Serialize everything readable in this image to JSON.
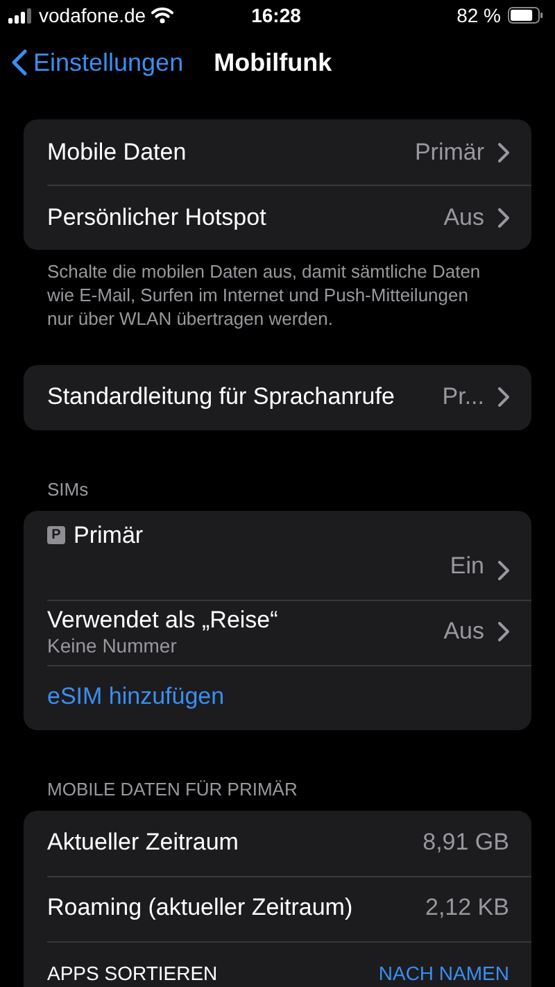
{
  "status_bar": {
    "carrier": "vodafone.de",
    "time": "16:28",
    "battery": "82 %"
  },
  "nav": {
    "back": "Einstellungen",
    "title": "Mobilfunk"
  },
  "sections": [
    {
      "rows": [
        {
          "kind": "value",
          "label": "Mobile Daten",
          "value": "Primär"
        },
        {
          "kind": "value",
          "label": "Persönlicher Hotspot",
          "value": "Aus"
        }
      ],
      "footer": "Schalte die mobilen Daten aus, damit sämtliche Daten wie E-Mail, Surfen im Internet und Push-Mitteilungen nur über WLAN übertragen werden."
    },
    {
      "rows": [
        {
          "kind": "value",
          "label": "Standardleitung für Sprachanrufe",
          "value": "Pr..."
        }
      ]
    },
    {
      "header": "SIMs",
      "rows": [
        {
          "kind": "sim",
          "badge": "P",
          "label": "Primär",
          "value": "Ein"
        },
        {
          "kind": "value",
          "label": "Verwendet als „Reise“",
          "subtitle": "Keine Nummer",
          "value": "Aus"
        },
        {
          "kind": "link",
          "label": "eSIM hinzufügen"
        }
      ]
    },
    {
      "header": "MOBILE DATEN FÜR PRIMÄR",
      "rows": [
        {
          "kind": "info",
          "label": "Aktueller Zeitraum",
          "value": "8,91 GB"
        },
        {
          "kind": "info",
          "label": "Roaming (aktueller Zeitraum)",
          "value": "2,12 KB"
        },
        {
          "kind": "sort",
          "label": "APPS SORTIEREN",
          "value": "NACH NAMEN"
        }
      ]
    }
  ]
}
